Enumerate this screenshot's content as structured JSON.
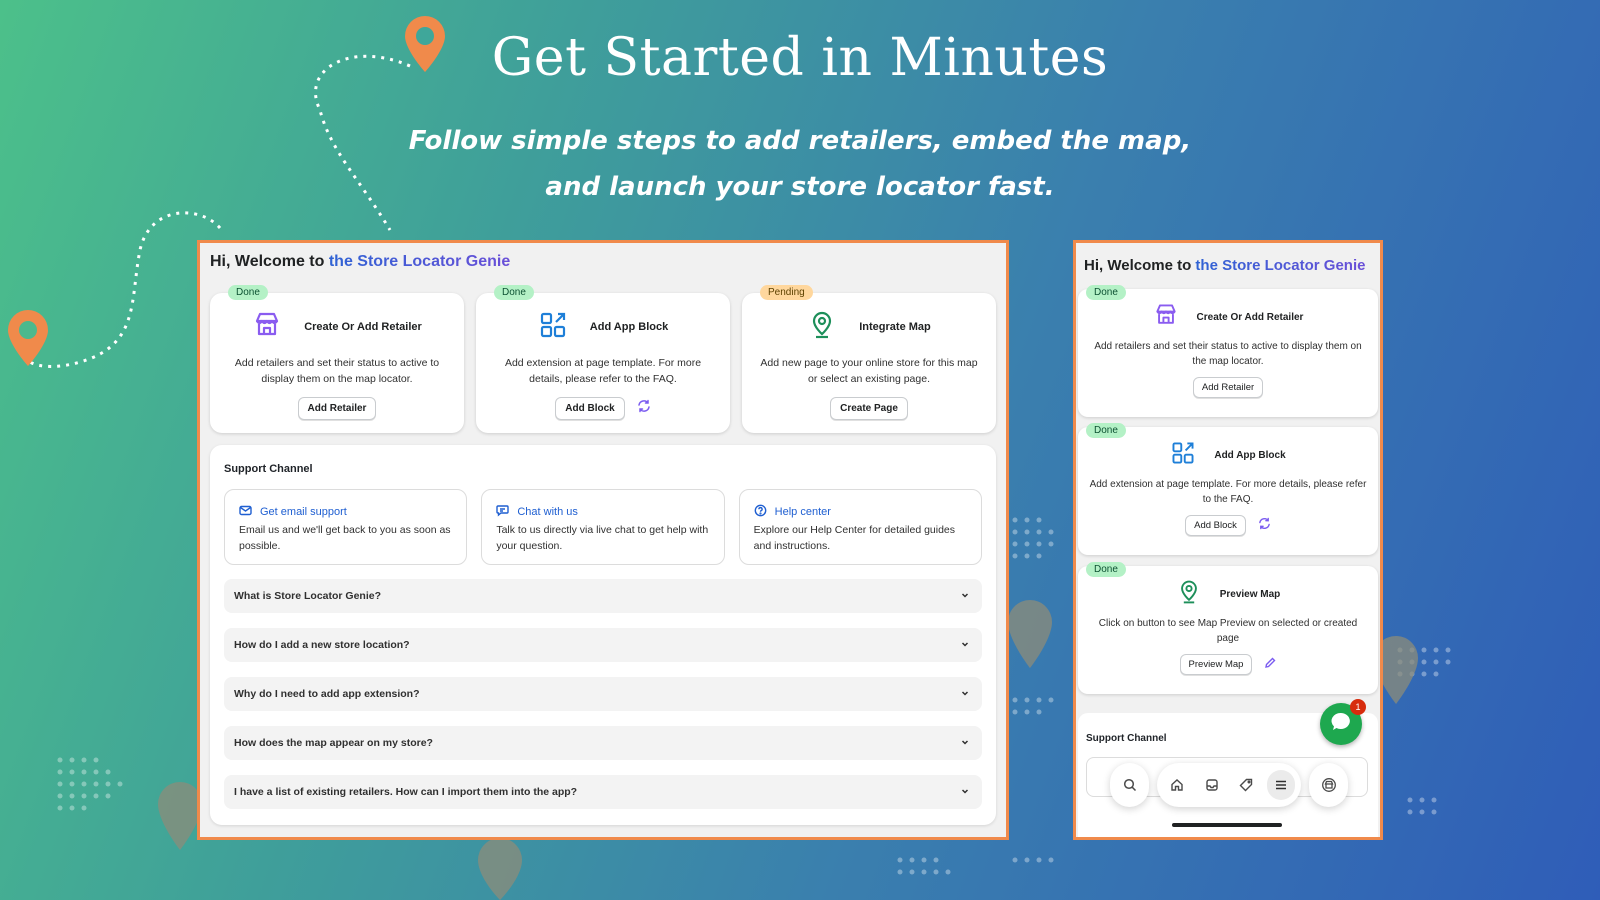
{
  "colors": {
    "accent_orange": "#f08a4b",
    "brand_blue": "#2f63d4",
    "done_badge": "#b4f1c6",
    "pending_badge": "#ffd79d",
    "chat_green": "#1ea84f"
  },
  "hero": {
    "title": "Get Started in Minutes",
    "subtitle_line1": "Follow simple steps to add retailers, embed the map,",
    "subtitle_line2": "and launch your store locator fast."
  },
  "desktop": {
    "greeting_prefix": "Hi, Welcome to",
    "greeting_brand": "the Store Locator Genie",
    "steps": [
      {
        "status": "Done",
        "icon": "store-icon",
        "title": "Create Or Add Retailer",
        "description": "Add retailers and set their status to active to display them on the map locator.",
        "button": "Add Retailer"
      },
      {
        "status": "Done",
        "icon": "app-block-icon",
        "title": "Add App Block",
        "description": "Add extension at page template. For more details, please refer to the FAQ.",
        "button": "Add Block",
        "extra_icon": "refresh-icon"
      },
      {
        "status": "Pending",
        "icon": "map-pin-icon",
        "title": "Integrate Map",
        "description": "Add new page to your online store for this map or select an existing page.",
        "button": "Create Page"
      }
    ],
    "support": {
      "title": "Support Channel",
      "channels": [
        {
          "icon": "mail-icon",
          "label": "Get email support",
          "description": "Email us and we'll get back to you as soon as possible."
        },
        {
          "icon": "chat-icon",
          "label": "Chat with us",
          "description": "Talk to us directly via live chat to get help with your question."
        },
        {
          "icon": "help-icon",
          "label": "Help center",
          "description": "Explore our Help Center for detailed guides and instructions."
        }
      ],
      "faqs": [
        "What is Store Locator Genie?",
        "How do I add a new store location?",
        "Why do I need to add app extension?",
        "How does the map appear on my store?",
        "I have a list of existing retailers. How can I import them into the app?"
      ]
    }
  },
  "mobile": {
    "greeting_prefix": "Hi, Welcome to",
    "greeting_brand": "the Store Locator Genie",
    "steps": [
      {
        "status": "Done",
        "icon": "store-icon",
        "title": "Create Or Add Retailer",
        "description": "Add retailers and set their status to active to display them on the map locator.",
        "button": "Add Retailer"
      },
      {
        "status": "Done",
        "icon": "app-block-icon",
        "title": "Add App Block",
        "description": "Add extension at page template. For more details, please refer to the FAQ.",
        "button": "Add Block",
        "extra_icon": "refresh-icon"
      },
      {
        "status": "Done",
        "icon": "map-pin-icon",
        "title": "Preview Map",
        "description": "Click on button to see Map Preview on selected or created page",
        "button": "Preview Map",
        "extra_icon": "pencil-icon"
      }
    ],
    "support_title": "Support Channel",
    "chat_unread": "1",
    "nav": [
      "search-icon",
      "home-icon",
      "inbox-icon",
      "tag-icon",
      "menu-icon",
      "store-app-icon"
    ]
  }
}
